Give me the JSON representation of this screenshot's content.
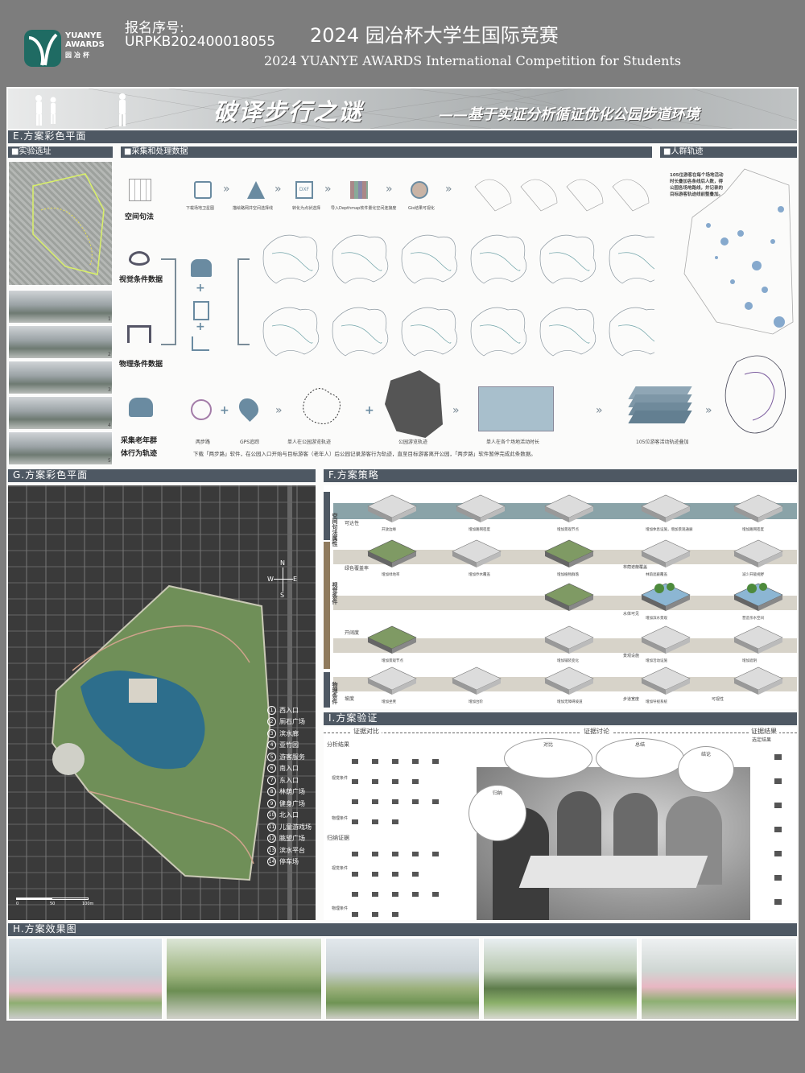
{
  "header": {
    "logo_line1": "YUANYE",
    "logo_line2": "AWARDS",
    "logo_cn": "园冶杯",
    "reg_label": "报名序号:",
    "reg_number": "URPKB202400018055",
    "title_cn": "2024 园冶杯大学生国际竞赛",
    "title_en": "2024 YUANYE AWARDS International Competition for  Students"
  },
  "banner": {
    "title": "破译步行之谜",
    "subtitle": "——基于实证分析循证优化公园步道环境"
  },
  "section_e": {
    "title": "E.方案彩色平面",
    "site_label": "■实验选址",
    "data_label": "■采集和处理数据",
    "crowd_label": "■人群轨迹",
    "space_syntax": "空间句法",
    "visual_data": "视觉条件数据",
    "physical_data": "物理条件数据",
    "elder_line1": "采集老年群",
    "elder_line2": "体行为轨迹",
    "steps": [
      "下载场地卫星图",
      "描绘路网并空间选择线",
      "转化为点状选择",
      "导入Depthmap软件量化空间连接度",
      "Gis结果可视化"
    ],
    "path_steps": [
      "两步路",
      "GPS追踪",
      "单人在公园游览轨迹",
      "公园游览轨迹",
      "单人在各个场地活动时长",
      "105位游客活动轨迹叠加"
    ],
    "caption": "下载「两步路」软件，在公园入口开始与目标游客（老年人）后公园记录游客行为轨迹，直至目标游客离开公园，「两步路」软件暂停完成此条数据。",
    "crowd_text": "105位游客在每个场地活动时长叠加各条线后人数，得公园各场地路线，并记录的目标游客轨迹线前整叠加。",
    "photo_numbers": [
      "1",
      "2",
      "3",
      "4",
      "5"
    ]
  },
  "section_g": {
    "title": "G.方案彩色平面",
    "legend": [
      "西入口",
      "厕石广场",
      "滨水廊",
      "亚竹园",
      "游客服务",
      "南入口",
      "东入口",
      "林荫广场",
      "健身广场",
      "北入口",
      "儿童游戏场",
      "眺望广场",
      "滨水平台",
      "停车场"
    ],
    "scale": [
      "0",
      "50",
      "100m"
    ],
    "compass": [
      "N",
      "W",
      "E",
      "S"
    ]
  },
  "section_f": {
    "title": "F.方案策略",
    "side_labels": [
      "空间句法属性",
      "视觉条件",
      "物理条件"
    ],
    "captions": [
      "开放边缘",
      "增加路网密度",
      "增加景观节点",
      "增加休息设施，增加景观通廊",
      "增加路网密度",
      "增加绿地率",
      "增加乔木覆盖",
      "增加植物群落",
      "林荫遮蔽覆盖",
      "减少开敞视野",
      "增加滨水景观",
      "营造亲水空间",
      "增加景观节点",
      "增加铺装变化",
      "增加活动设施",
      "增加遮阴",
      "增加坐凳",
      "增加台阶",
      "增加无障碍坡道",
      "增加导视系统"
    ],
    "icons_left": [
      "可达性",
      "绿色覆盖率",
      "开阔度",
      "坡度"
    ],
    "icons_right": [
      "林荫遮蔽覆盖",
      "水体可见",
      "景观设施",
      "步道宽度",
      "可视性"
    ]
  },
  "section_i": {
    "title": "I.方案验证",
    "col1": "证据对比",
    "col2": "证据讨论",
    "col3": "证据结果",
    "col3_sub": "选定结果",
    "analysis": "分析结果",
    "induction": "归纳证据",
    "rows": [
      "视觉条件",
      "物理条件",
      "视觉条件",
      "物理条件"
    ],
    "bubble1_title": "对比",
    "bubble2_title": "总结",
    "bubble3_title": "归纳",
    "bubble4_title": "结论"
  },
  "section_h": {
    "title": "H.方案效果图"
  },
  "colors": {
    "header_bg": "#7d7d7d",
    "bar_bg": "#4e5863",
    "accent_teal": "#2f6d6e",
    "water": "#2d6e8c"
  }
}
